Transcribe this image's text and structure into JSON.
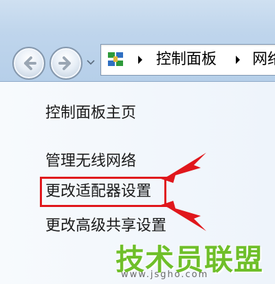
{
  "address_bar": {
    "crumbs": [
      "控制面板",
      "网络"
    ]
  },
  "sidebar": {
    "items": [
      {
        "label": "控制面板主页"
      },
      {
        "label": "管理无线网络"
      },
      {
        "label": "更改适配器设置"
      },
      {
        "label": "更改高级共享设置"
      }
    ]
  },
  "annotation": {
    "highlight_color": "#e0171c"
  },
  "watermark": {
    "title": "技术员联盟",
    "url": "www.jsgho.com"
  },
  "icons": {
    "back": "back-arrow-icon",
    "forward": "forward-arrow-icon",
    "dropdown": "chevron-down-icon",
    "control_panel": "control-panel-icon",
    "breadcrumb_separator": "triangle-right-icon"
  }
}
